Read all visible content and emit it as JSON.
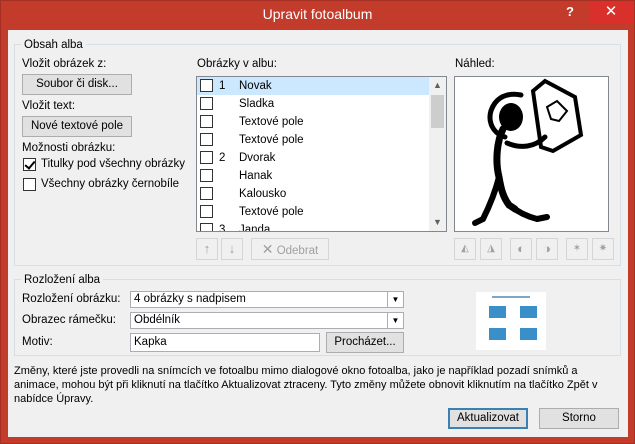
{
  "window": {
    "title": "Upravit fotoalbum",
    "help_label": "?",
    "close_label": "✕"
  },
  "album_content": {
    "legend": "Obsah alba",
    "insert_picture_label": "Vložit obrázek z:",
    "file_disk_button": "Soubor či disk...",
    "insert_text_label": "Vložit text:",
    "new_textbox_button": "Nové textové pole",
    "picture_options_label": "Možnosti obrázku:",
    "captions_option": {
      "label": "Titulky pod všechny obrázky",
      "checked": true
    },
    "bw_option": {
      "label": "Všechny obrázky černobíle",
      "checked": false
    }
  },
  "pictures_list": {
    "label": "Obrázky v albu:",
    "items": [
      {
        "num": "1",
        "name": "Novak",
        "checked": false,
        "selected": true
      },
      {
        "num": "",
        "name": "Sladka",
        "checked": false,
        "selected": false
      },
      {
        "num": "",
        "name": "Textové pole",
        "checked": false,
        "selected": false
      },
      {
        "num": "",
        "name": "Textové pole",
        "checked": false,
        "selected": false
      },
      {
        "num": "2",
        "name": "Dvorak",
        "checked": false,
        "selected": false
      },
      {
        "num": "",
        "name": "Hanak",
        "checked": false,
        "selected": false
      },
      {
        "num": "",
        "name": "Kalousko",
        "checked": false,
        "selected": false
      },
      {
        "num": "",
        "name": "Textové pole",
        "checked": false,
        "selected": false
      },
      {
        "num": "3",
        "name": "Janda",
        "checked": false,
        "selected": false
      }
    ],
    "remove_button": "Odebrat"
  },
  "preview": {
    "label": "Náhled:"
  },
  "album_layout": {
    "legend": "Rozložení alba",
    "picture_layout_label": "Rozložení obrázku:",
    "picture_layout_value": "4 obrázky s nadpisem",
    "frame_shape_label": "Obrazec rámečku:",
    "frame_shape_value": "Obdélník",
    "theme_label": "Motiv:",
    "theme_value": "Kapka",
    "browse_button": "Procházet..."
  },
  "info_text": "Změny, které jste provedli na snímcích ve fotoalbu mimo dialogové okno fotoalba, jako je například pozadí snímků a animace, mohou být při kliknutí na tlačítko Aktualizovat ztraceny. Tyto změny můžete obnovit kliknutím na tlačítko Zpět v nabídce Úpravy.",
  "footer": {
    "update_button": "Aktualizovat",
    "cancel_button": "Storno"
  },
  "colors": {
    "titlebar": "#c23b2b",
    "selection": "#cce8ff"
  }
}
